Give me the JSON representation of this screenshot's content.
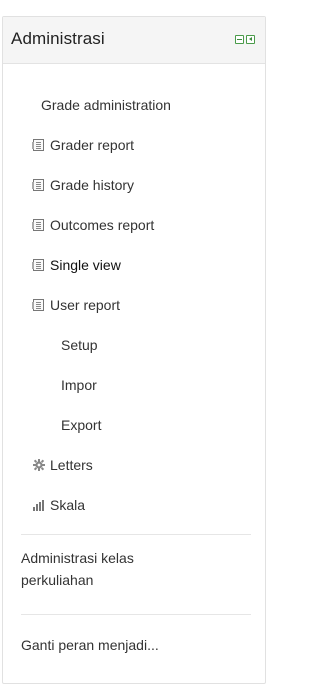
{
  "block": {
    "title": "Administrasi",
    "controls": [
      "minus-icon",
      "dock-icon"
    ]
  },
  "nav": {
    "grade_admin": "Grade administration",
    "grader_report": "Grader report",
    "grade_history": "Grade history",
    "outcomes_report": "Outcomes report",
    "single_view": "Single view",
    "user_report": "User report",
    "setup": "Setup",
    "impor": "Impor",
    "export": "Export",
    "letters": "Letters",
    "skala": "Skala",
    "course_admin_line1": "Administrasi kelas",
    "course_admin_line2": "perkuliahan",
    "switch_role": "Ganti peran menjadi..."
  },
  "icons": {
    "report": "report-icon",
    "letters": "gear-icon",
    "skala": "bar-chart-icon"
  },
  "colors": {
    "control_green": "#4a9b4a",
    "header_bg": "#f5f5f5",
    "text": "#333333"
  }
}
